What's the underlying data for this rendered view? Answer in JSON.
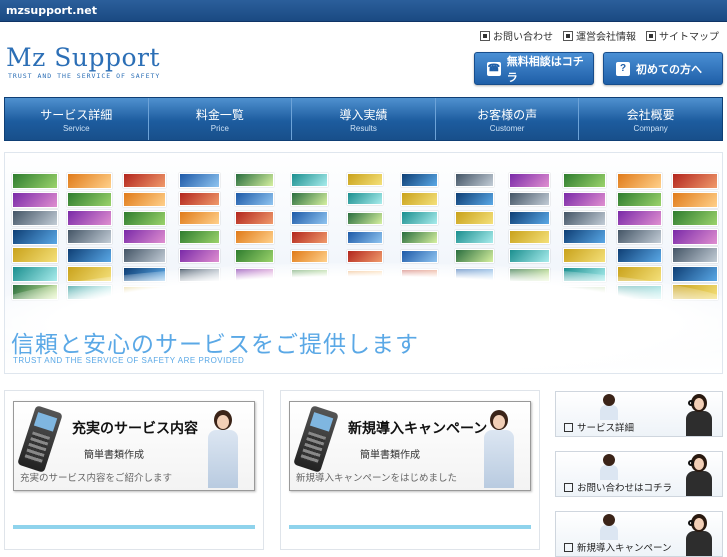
{
  "topbar": {
    "domain": "mzsupport.net"
  },
  "header": {
    "logo_title": "Mz Support",
    "logo_sub": "TRUST AND THE SERVICE OF SAFETY",
    "links": [
      "お問い合わせ",
      "運営会社情報",
      "サイトマップ"
    ],
    "btn_consult": "無料相談はコチラ",
    "btn_first": "初めての方へ"
  },
  "nav": [
    {
      "ja": "サービス詳細",
      "en": "Service"
    },
    {
      "ja": "料金一覧",
      "en": "Price"
    },
    {
      "ja": "導入実績",
      "en": "Results"
    },
    {
      "ja": "お客様の声",
      "en": "Customer"
    },
    {
      "ja": "会社概要",
      "en": "Company"
    }
  ],
  "hero": {
    "title": "信頼と安心のサービスをご提供します",
    "subtitle": "TRUST AND THE SERVICE OF SAFETY ARE PROVIDED"
  },
  "cards": [
    {
      "title": "充実のサービス内容",
      "sub": "簡単書類作成",
      "desc": "充実のサービス内容をご紹介します"
    },
    {
      "title": "新規導入キャンペーン",
      "sub": "簡単書類作成",
      "desc": "新規導入キャンペーンをはじめました"
    }
  ],
  "side": [
    {
      "label": "サービス詳細"
    },
    {
      "label": "お問い合わせはコチラ"
    },
    {
      "label": "新規導入キャンペーン"
    }
  ],
  "colors": {
    "brand": "#2c6fb6",
    "nav": "#1d5c9f",
    "hero_text": "#5aa8e6",
    "accent_line": "#8fd3ec"
  }
}
